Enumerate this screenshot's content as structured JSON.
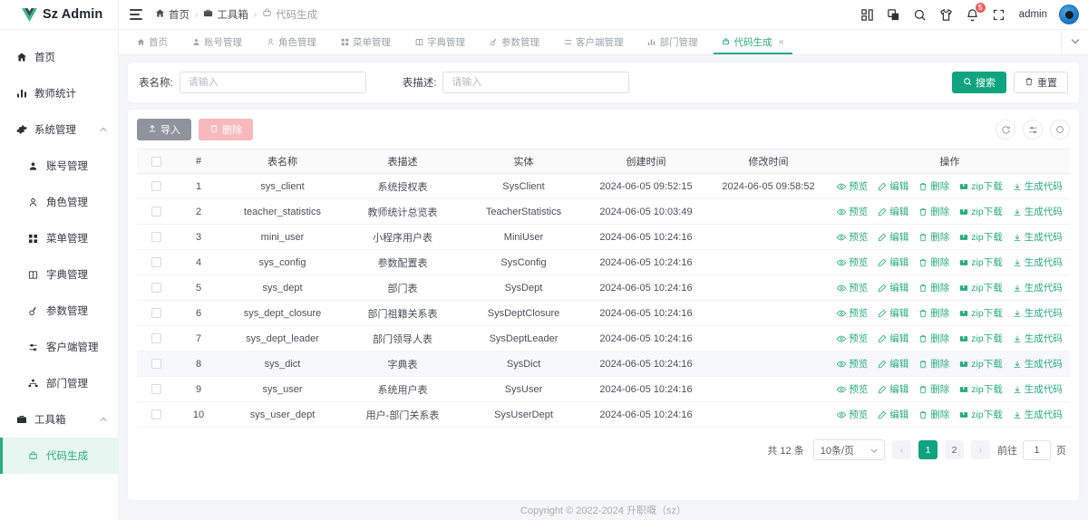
{
  "brand": {
    "name": "Sz Admin"
  },
  "breadcrumb": [
    {
      "label": "首页",
      "icon": "home-icon"
    },
    {
      "label": "工具箱",
      "icon": "toolbox-icon"
    },
    {
      "label": "代码生成",
      "icon": "code-icon"
    }
  ],
  "header": {
    "username": "admin",
    "notification_count": "5",
    "icons": [
      "layout-icon",
      "theme-icon",
      "search-icon",
      "shirt-icon",
      "bell-icon",
      "fullscreen-icon"
    ]
  },
  "sidebar": {
    "items": [
      {
        "label": "首页",
        "icon": "home-icon",
        "level": "top",
        "active": false
      },
      {
        "label": "教师统计",
        "icon": "chart-icon",
        "level": "top",
        "active": false
      },
      {
        "label": "系统管理",
        "icon": "gear-icon",
        "level": "group",
        "active": false,
        "expanded": true
      },
      {
        "label": "账号管理",
        "icon": "user-icon",
        "level": "child",
        "active": false
      },
      {
        "label": "角色管理",
        "icon": "role-icon",
        "level": "child",
        "active": false
      },
      {
        "label": "菜单管理",
        "icon": "menu-grid-icon",
        "level": "child",
        "active": false
      },
      {
        "label": "字典管理",
        "icon": "book-icon",
        "level": "child",
        "active": false
      },
      {
        "label": "参数管理",
        "icon": "key-icon",
        "level": "child",
        "active": false
      },
      {
        "label": "客户端管理",
        "icon": "sliders-icon",
        "level": "child",
        "active": false
      },
      {
        "label": "部门管理",
        "icon": "dept-icon",
        "level": "child",
        "active": false
      },
      {
        "label": "工具箱",
        "icon": "toolbox-icon",
        "level": "group",
        "active": false,
        "expanded": true
      },
      {
        "label": "代码生成",
        "icon": "code-icon",
        "level": "child",
        "active": true
      }
    ]
  },
  "tabs": [
    {
      "label": "首页",
      "icon": "home-icon",
      "active": false,
      "closable": false
    },
    {
      "label": "账号管理",
      "icon": "user-icon",
      "active": false,
      "closable": false
    },
    {
      "label": "角色管理",
      "icon": "role-icon",
      "active": false,
      "closable": false
    },
    {
      "label": "菜单管理",
      "icon": "menu-grid-icon",
      "active": false,
      "closable": false
    },
    {
      "label": "字典管理",
      "icon": "book-icon",
      "active": false,
      "closable": false
    },
    {
      "label": "参数管理",
      "icon": "key-icon",
      "active": false,
      "closable": false
    },
    {
      "label": "客户端管理",
      "icon": "sliders-icon",
      "active": false,
      "closable": false
    },
    {
      "label": "部门管理",
      "icon": "dept-icon",
      "active": false,
      "closable": false
    },
    {
      "label": "代码生成",
      "icon": "code-icon",
      "active": true,
      "closable": true
    }
  ],
  "filter": {
    "table_name_label": "表名称:",
    "table_name_value": "",
    "table_name_placeholder": "请输入",
    "table_desc_label": "表描述:",
    "table_desc_value": "",
    "table_desc_placeholder": "请输入",
    "search_label": "搜索",
    "reset_label": "重置"
  },
  "toolbar": {
    "import_label": "导入",
    "delete_label": "删除",
    "round_icons": [
      "refresh-icon",
      "column-settings-icon",
      "search-icon"
    ]
  },
  "table": {
    "columns": [
      "#",
      "表名称",
      "表描述",
      "实体",
      "创建时间",
      "修改时间",
      "操作"
    ],
    "actions": [
      "预览",
      "编辑",
      "删除",
      "zip下载",
      "生成代码"
    ],
    "rows": [
      {
        "idx": "1",
        "name": "sys_client",
        "desc": "系统授权表",
        "entity": "SysClient",
        "created": "2024-06-05 09:52:15",
        "modified": "2024-06-05 09:58:52",
        "hovered": false
      },
      {
        "idx": "2",
        "name": "teacher_statistics",
        "desc": "教师统计总览表",
        "entity": "TeacherStatistics",
        "created": "2024-06-05 10:03:49",
        "modified": "",
        "hovered": false
      },
      {
        "idx": "3",
        "name": "mini_user",
        "desc": "小程序用户表",
        "entity": "MiniUser",
        "created": "2024-06-05 10:24:16",
        "modified": "",
        "hovered": false
      },
      {
        "idx": "4",
        "name": "sys_config",
        "desc": "参数配置表",
        "entity": "SysConfig",
        "created": "2024-06-05 10:24:16",
        "modified": "",
        "hovered": false
      },
      {
        "idx": "5",
        "name": "sys_dept",
        "desc": "部门表",
        "entity": "SysDept",
        "created": "2024-06-05 10:24:16",
        "modified": "",
        "hovered": false
      },
      {
        "idx": "6",
        "name": "sys_dept_closure",
        "desc": "部门祖籍关系表",
        "entity": "SysDeptClosure",
        "created": "2024-06-05 10:24:16",
        "modified": "",
        "hovered": false
      },
      {
        "idx": "7",
        "name": "sys_dept_leader",
        "desc": "部门领导人表",
        "entity": "SysDeptLeader",
        "created": "2024-06-05 10:24:16",
        "modified": "",
        "hovered": false
      },
      {
        "idx": "8",
        "name": "sys_dict",
        "desc": "字典表",
        "entity": "SysDict",
        "created": "2024-06-05 10:24:16",
        "modified": "",
        "hovered": true
      },
      {
        "idx": "9",
        "name": "sys_user",
        "desc": "系统用户表",
        "entity": "SysUser",
        "created": "2024-06-05 10:24:16",
        "modified": "",
        "hovered": false
      },
      {
        "idx": "10",
        "name": "sys_user_dept",
        "desc": "用户-部门关系表",
        "entity": "SysUserDept",
        "created": "2024-06-05 10:24:16",
        "modified": "",
        "hovered": false
      }
    ]
  },
  "pagination": {
    "total_text": "共 12 条",
    "page_size": "10条/页",
    "prev": "‹",
    "next": "›",
    "pages": [
      "1",
      "2"
    ],
    "current_page": "1",
    "jump_prefix": "前往",
    "jump_value": "1",
    "jump_suffix": "页"
  },
  "footer": {
    "copyright": "Copyright © 2022-2024 升职嘅（sz）"
  },
  "colors": {
    "accent": "#10a37f",
    "accent_light": "#2aab7f",
    "danger": "#f7b9bc",
    "gray": "#8f949c",
    "badge": "#f35b5b"
  }
}
